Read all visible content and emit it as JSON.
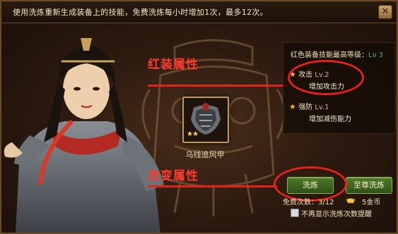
{
  "header": {
    "message": "使用洗炼重新生成装备上的技能，免费洗炼每小时增加1次，最多12次。",
    "close_label": "✕"
  },
  "annotations": {
    "red_equip_attr": "红装属性",
    "change_attr": "改变属性"
  },
  "item": {
    "name": "乌线追风甲",
    "stars": "★★",
    "star_count": 2,
    "icon": "armor-icon"
  },
  "skills_panel": {
    "title_prefix": "红色装备技能最高等级：",
    "title_level": "Lv 3",
    "skills": [
      {
        "name": "攻击",
        "level": "Lv.2",
        "description": "增加攻击力"
      },
      {
        "name": "强防",
        "level": "Lv.1",
        "description": "增加减伤能力"
      }
    ]
  },
  "buttons": {
    "refine": "洗炼",
    "supreme_refine": "至尊洗炼"
  },
  "status": {
    "free_count_label": "免费次数：3/12",
    "gold": "5金币"
  },
  "option": {
    "dont_show_label": "不再显示洗炼次数提醒",
    "checked": false
  },
  "colors": {
    "annotation_red": "#e2231a",
    "level_green": "#5fb83a",
    "button_green": "#4f7a2a",
    "star_gold": "#ffd24a"
  }
}
